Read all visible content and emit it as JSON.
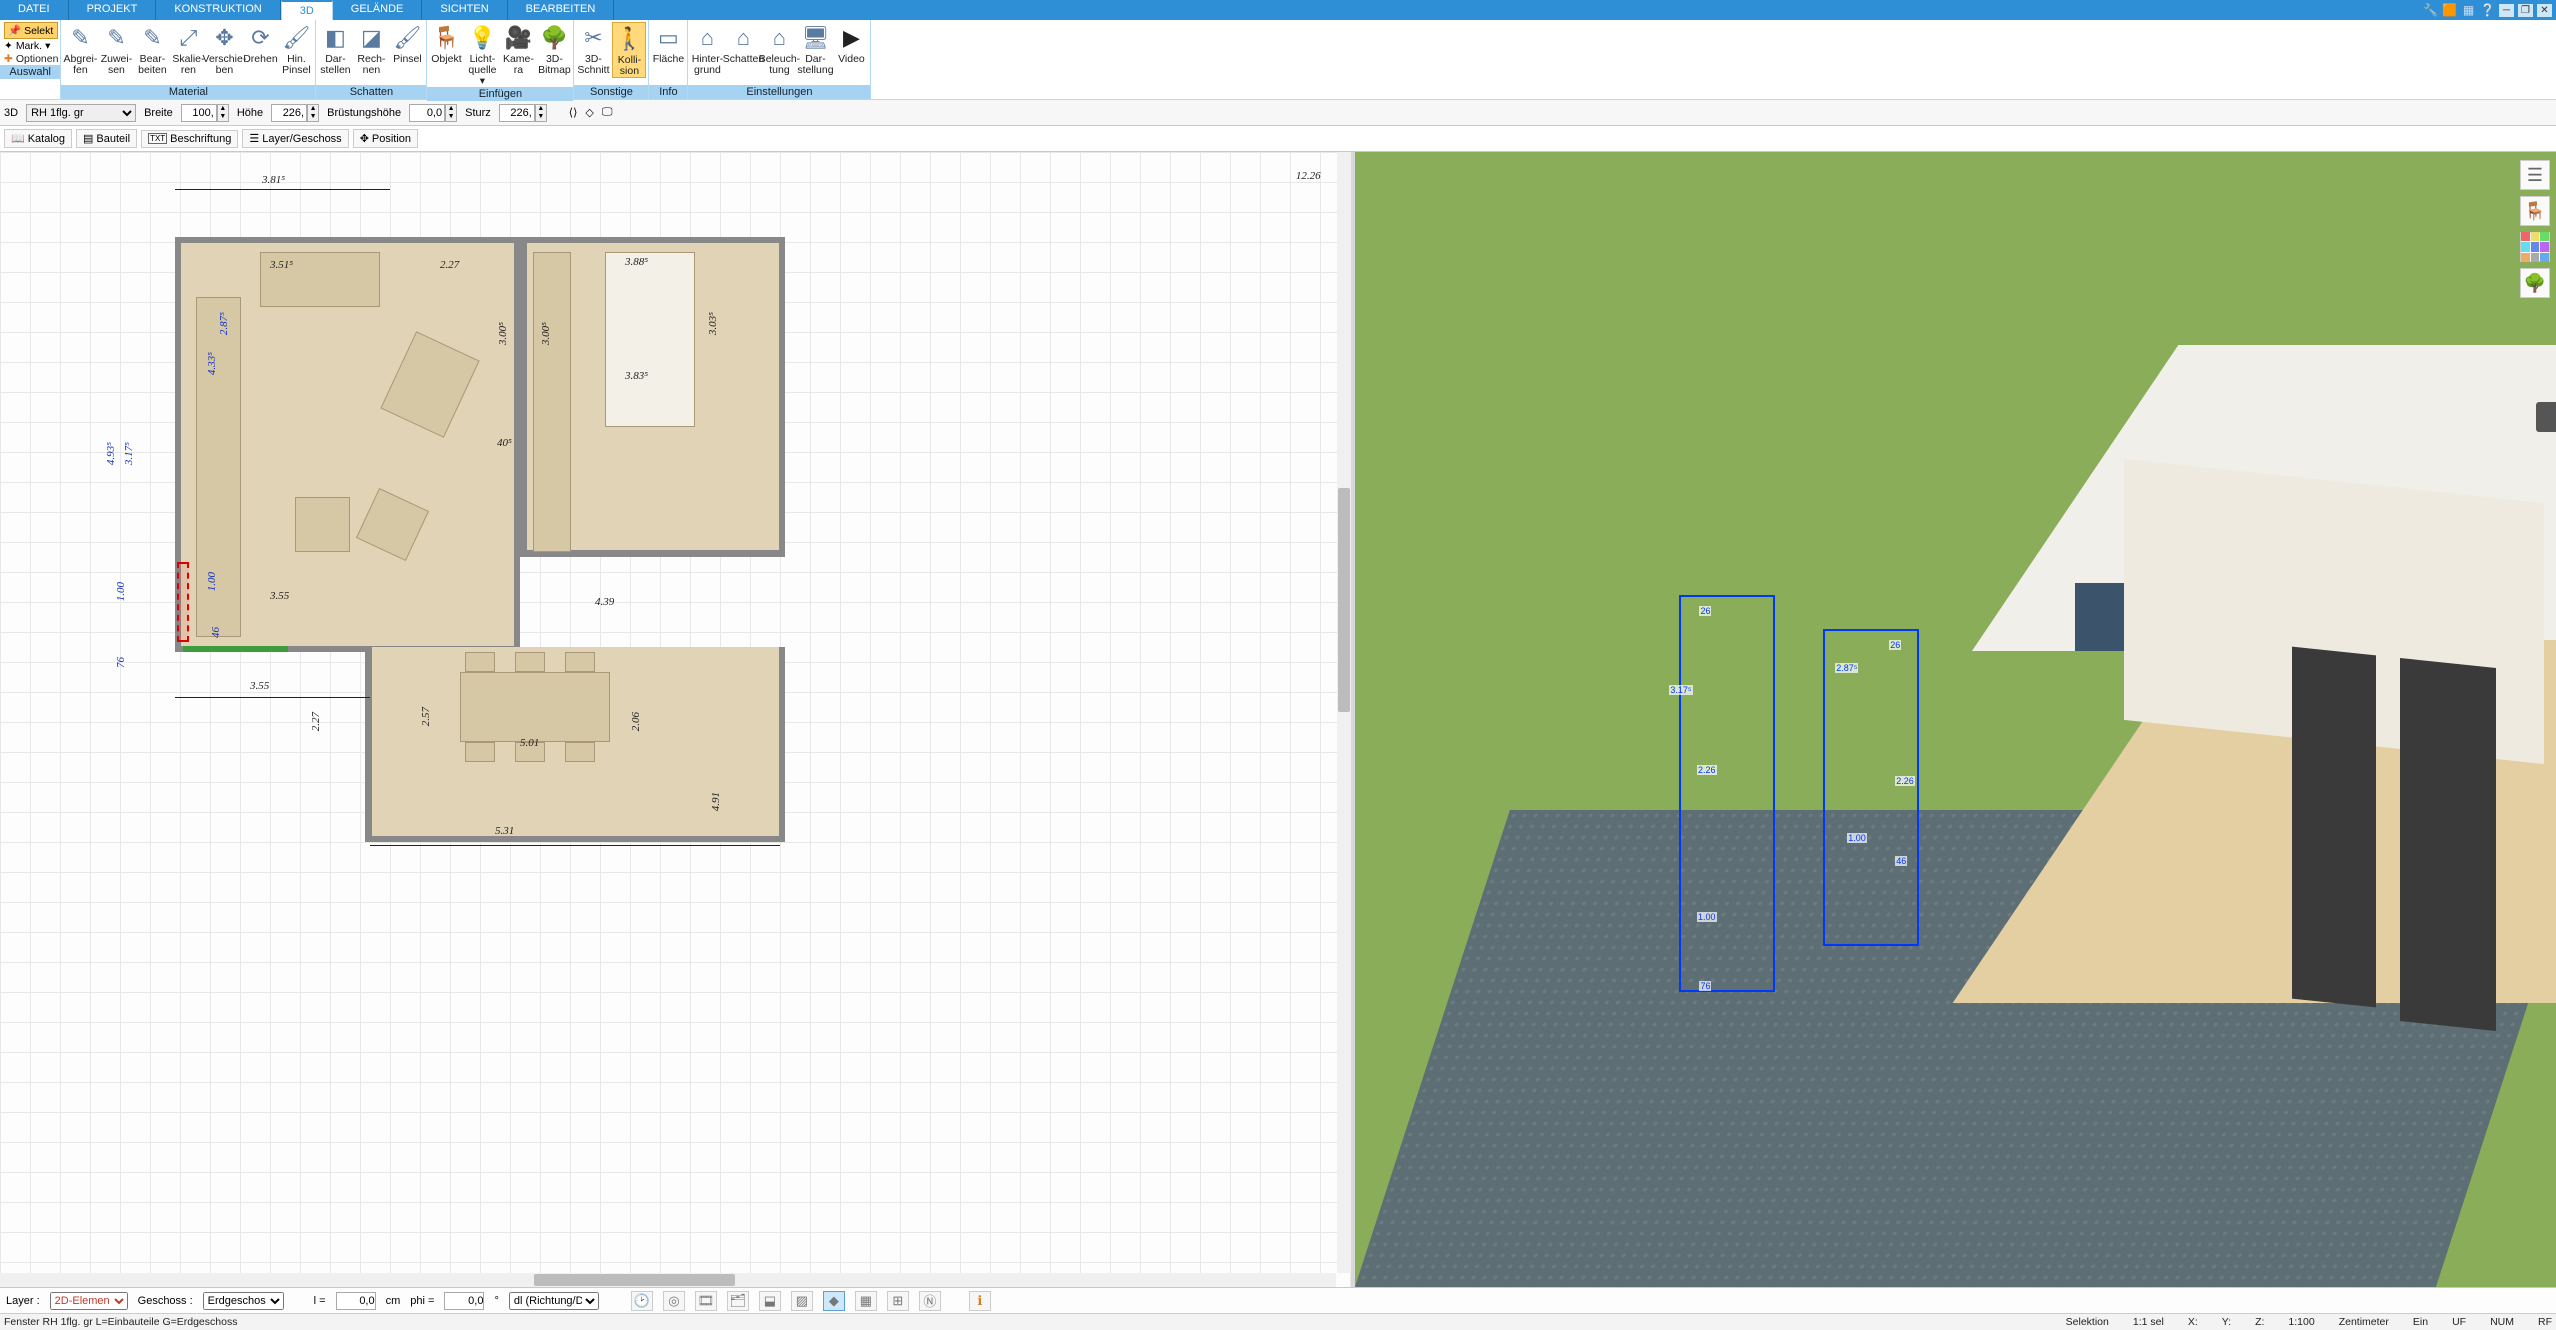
{
  "window": {
    "icons": [
      "wrench",
      "color",
      "window",
      "help",
      "min",
      "restore",
      "close"
    ]
  },
  "tabs": {
    "items": [
      "DATEI",
      "PROJEKT",
      "KONSTRUKTION",
      "3D",
      "GELÄNDE",
      "SICHTEN",
      "BEARBEITEN"
    ],
    "active": 3
  },
  "ribbon": {
    "auswahl": {
      "label": "Auswahl",
      "selekt": "Selekt",
      "mark": "Mark.",
      "optionen": "Optionen"
    },
    "material": {
      "label": "Material",
      "btns": [
        {
          "l1": "Abgrei-",
          "l2": "fen"
        },
        {
          "l1": "Zuwei-",
          "l2": "sen"
        },
        {
          "l1": "Bear-",
          "l2": "beiten"
        },
        {
          "l1": "Skalie-",
          "l2": "ren"
        },
        {
          "l1": "Verschie-",
          "l2": "ben"
        },
        {
          "l1": "Drehen",
          "l2": ""
        },
        {
          "l1": "Hin.",
          "l2": "Pinsel"
        }
      ]
    },
    "schatten": {
      "label": "Schatten",
      "btns": [
        {
          "l1": "Dar-",
          "l2": "stellen"
        },
        {
          "l1": "Rech-",
          "l2": "nen"
        },
        {
          "l1": "Pinsel",
          "l2": ""
        }
      ]
    },
    "einfuegen": {
      "label": "Einfügen",
      "btns": [
        {
          "l1": "Objekt",
          "l2": ""
        },
        {
          "l1": "Licht-",
          "l2": "quelle ▾"
        },
        {
          "l1": "Kame-",
          "l2": "ra"
        },
        {
          "l1": "3D-",
          "l2": "Bitmap"
        }
      ]
    },
    "sonstige": {
      "label": "Sonstige",
      "btns": [
        {
          "l1": "3D-",
          "l2": "Schnitt"
        },
        {
          "l1": "Kolli-",
          "l2": "sion",
          "active": true
        }
      ]
    },
    "info": {
      "label": "Info",
      "btns": [
        {
          "l1": "Fläche",
          "l2": ""
        }
      ]
    },
    "einstellungen": {
      "label": "Einstellungen",
      "btns": [
        {
          "l1": "Hinter-",
          "l2": "grund"
        },
        {
          "l1": "Schatten",
          "l2": ""
        },
        {
          "l1": "Beleuch-",
          "l2": "tung"
        },
        {
          "l1": "Dar-",
          "l2": "stellung"
        },
        {
          "l1": "Video",
          "l2": ""
        }
      ]
    }
  },
  "propbar": {
    "mode": "3D",
    "element": "RH 1flg. gr",
    "breite_label": "Breite",
    "breite": "100,",
    "hoehe_label": "Höhe",
    "hoehe": "226,",
    "bruest_label": "Brüstungshöhe",
    "bruest": "0,0",
    "sturz_label": "Sturz",
    "sturz": "226,"
  },
  "toolbar3": {
    "katalog": "Katalog",
    "bauteil": "Bauteil",
    "beschriftung": "Beschriftung",
    "layer": "Layer/Geschoss",
    "position": "Position"
  },
  "plan": {
    "dims": {
      "d_381": "3.81⁵",
      "d_1226": "12.26",
      "d_351": "3.51⁵",
      "d_227a": "2.27",
      "d_388": "3.88⁵",
      "d_493": "4.93⁵",
      "d_317": "3.17⁵",
      "d_287": "2.87⁵",
      "d_433": "4.33⁵",
      "d_100": "1.00",
      "d_100b": "1.00",
      "d_76": "76",
      "d_46": "46",
      "d_355a": "3.55",
      "d_355b": "3.55",
      "d_300": "3.00⁵",
      "d_300b": "3.00⁵",
      "d_40": "40⁵",
      "d_303": "3.03⁵",
      "d_383b": "3.83⁵",
      "d_439": "4.39",
      "d_227b": "2.27",
      "d_257": "2.57",
      "d_206": "2.06",
      "d_501": "5.01",
      "d_531": "5.31",
      "d_491": "4.91"
    }
  },
  "view3d": {
    "dims": {
      "a": "3.17⁵",
      "b": "2.26",
      "c": "1.00",
      "d": "76",
      "e": "2.87⁵",
      "f": "2.26",
      "g": "1.00",
      "h": "46",
      "i": "26",
      "j": "26"
    }
  },
  "bottombar": {
    "layer_label": "Layer :",
    "layer_value": "2D-Elemen",
    "geschoss_label": "Geschoss :",
    "geschoss_value": "Erdgeschos",
    "l_label": "l =",
    "l_value": "0,0",
    "l_unit": "cm",
    "phi_label": "phi =",
    "phi_value": "0,0",
    "phi_unit": "°",
    "dl_label": "dl (Richtung/Di"
  },
  "status": {
    "left": "Fenster RH 1flg. gr L=Einbauteile G=Erdgeschoss",
    "selektion": "Selektion",
    "sel": "1:1 sel",
    "x": "X:",
    "y": "Y:",
    "z": "Z:",
    "scale": "1:100",
    "unit": "Zentimeter",
    "ein": "Ein",
    "uf": "UF",
    "num": "NUM",
    "rf": "RF"
  }
}
